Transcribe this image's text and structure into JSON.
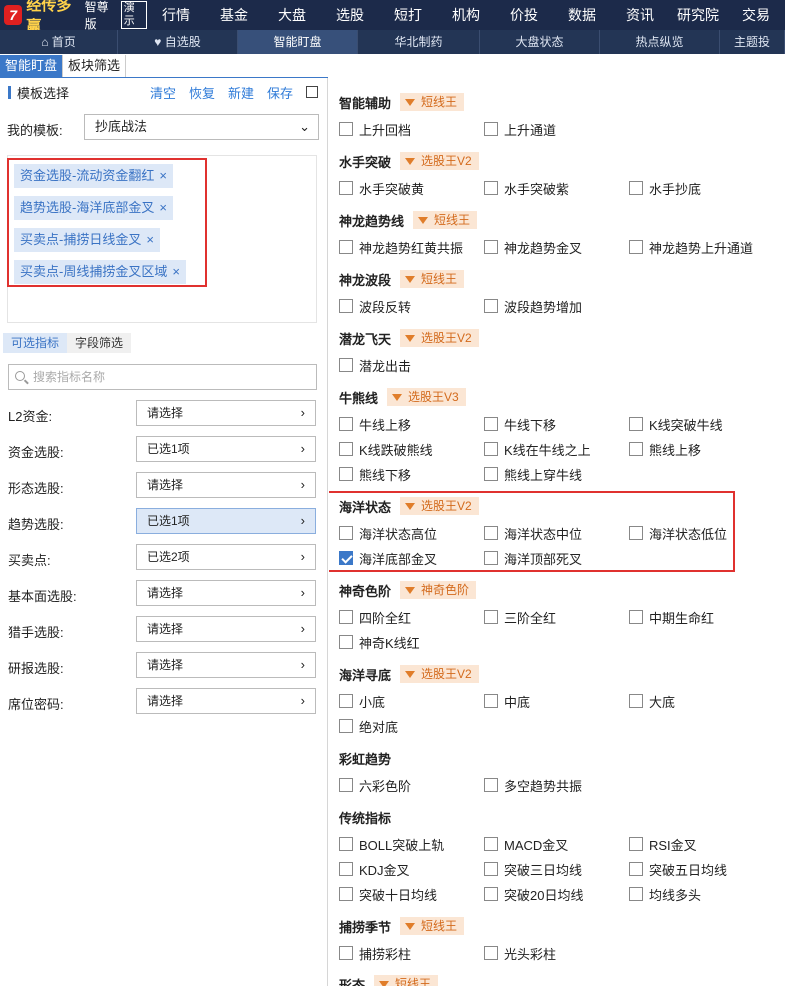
{
  "app": {
    "logo_text": "经传多赢",
    "edition": "智尊版",
    "demo": "演示"
  },
  "topnav": [
    "行情",
    "基金",
    "大盘",
    "选股",
    "短打",
    "机构",
    "价投",
    "数据",
    "资讯",
    "研究院",
    "交易"
  ],
  "tabs": [
    "首页",
    "自选股",
    "智能盯盘",
    "华北制药",
    "大盘状态",
    "热点纵览",
    "主题投"
  ],
  "subtabs": [
    "智能盯盘",
    "板块筛选"
  ],
  "template": {
    "title": "模板选择",
    "actions": [
      "清空",
      "恢复",
      "新建",
      "保存"
    ],
    "my_label": "我的模板:",
    "my_value": "抄底战法"
  },
  "tags": [
    "资金选股-流动资金翻红",
    "趋势选股-海洋底部金叉",
    "买卖点-捕捞日线金叉",
    "买卖点-周线捕捞金叉区域"
  ],
  "filter_tabs": [
    "可选指标",
    "字段筛选"
  ],
  "search_placeholder": "搜索指标名称",
  "filters": [
    {
      "label": "L2资金:",
      "value": "请选择"
    },
    {
      "label": "资金选股:",
      "value": "已选1项"
    },
    {
      "label": "形态选股:",
      "value": "请选择"
    },
    {
      "label": "趋势选股:",
      "value": "已选1项"
    },
    {
      "label": "买卖点:",
      "value": "已选2项"
    },
    {
      "label": "基本面选股:",
      "value": "请选择"
    },
    {
      "label": "猎手选股:",
      "value": "请选择"
    },
    {
      "label": "研报选股:",
      "value": "请选择"
    },
    {
      "label": "席位密码:",
      "value": "请选择"
    }
  ],
  "groups": [
    {
      "title": "智能辅助",
      "badge": "短线王",
      "items": [
        {
          "t": "上升回档",
          "c": false
        },
        {
          "t": "上升通道",
          "c": false
        }
      ]
    },
    {
      "title": "水手突破",
      "badge": "选股王V2",
      "items": [
        {
          "t": "水手突破黄",
          "c": false
        },
        {
          "t": "水手突破紫",
          "c": false
        },
        {
          "t": "水手抄底",
          "c": false
        }
      ]
    },
    {
      "title": "神龙趋势线",
      "badge": "短线王",
      "items": [
        {
          "t": "神龙趋势红黄共振",
          "c": false
        },
        {
          "t": "神龙趋势金叉",
          "c": false
        },
        {
          "t": "神龙趋势上升通道",
          "c": false
        }
      ]
    },
    {
      "title": "神龙波段",
      "badge": "短线王",
      "items": [
        {
          "t": "波段反转",
          "c": false
        },
        {
          "t": "波段趋势增加",
          "c": false
        }
      ]
    },
    {
      "title": "潜龙飞天",
      "badge": "选股王V2",
      "items": [
        {
          "t": "潜龙出击",
          "c": false
        }
      ]
    },
    {
      "title": "牛熊线",
      "badge": "选股王V3",
      "items": [
        {
          "t": "牛线上移",
          "c": false
        },
        {
          "t": "牛线下移",
          "c": false
        },
        {
          "t": "K线突破牛线",
          "c": false
        },
        {
          "t": "K线跌破熊线",
          "c": false
        },
        {
          "t": "K线在牛线之上",
          "c": false
        },
        {
          "t": "熊线上移",
          "c": false
        },
        {
          "t": "熊线下移",
          "c": false
        },
        {
          "t": "熊线上穿牛线",
          "c": false
        }
      ]
    },
    {
      "title": "海洋状态",
      "badge": "选股王V2",
      "items": [
        {
          "t": "海洋状态高位",
          "c": false
        },
        {
          "t": "海洋状态中位",
          "c": false
        },
        {
          "t": "海洋状态低位",
          "c": false
        },
        {
          "t": "海洋底部金叉",
          "c": true
        },
        {
          "t": "海洋顶部死叉",
          "c": false
        }
      ]
    },
    {
      "title": "神奇色阶",
      "badge": "神奇色阶",
      "items": [
        {
          "t": "四阶全红",
          "c": false
        },
        {
          "t": "三阶全红",
          "c": false
        },
        {
          "t": "中期生命红",
          "c": false
        },
        {
          "t": "神奇K线红",
          "c": false
        }
      ]
    },
    {
      "title": "海洋寻底",
      "badge": "选股王V2",
      "items": [
        {
          "t": "小底",
          "c": false
        },
        {
          "t": "中底",
          "c": false
        },
        {
          "t": "大底",
          "c": false
        },
        {
          "t": "绝对底",
          "c": false
        }
      ]
    },
    {
      "title": "彩虹趋势",
      "badge": "",
      "items": [
        {
          "t": "六彩色阶",
          "c": false
        },
        {
          "t": "多空趋势共振",
          "c": false
        }
      ]
    },
    {
      "title": "传统指标",
      "badge": "",
      "items": [
        {
          "t": "BOLL突破上轨",
          "c": false
        },
        {
          "t": "MACD金叉",
          "c": false
        },
        {
          "t": "RSI金叉",
          "c": false
        },
        {
          "t": "KDJ金叉",
          "c": false
        },
        {
          "t": "突破三日均线",
          "c": false
        },
        {
          "t": "突破五日均线",
          "c": false
        },
        {
          "t": "突破十日均线",
          "c": false
        },
        {
          "t": "突破20日均线",
          "c": false
        },
        {
          "t": "均线多头",
          "c": false
        }
      ]
    },
    {
      "title": "捕捞季节",
      "badge": "短线王",
      "items": [
        {
          "t": "捕捞彩柱",
          "c": false
        },
        {
          "t": "光头彩柱",
          "c": false
        }
      ]
    },
    {
      "title": "形态",
      "badge": "短线王",
      "items": []
    }
  ],
  "colors": {
    "accent": "#3b78c8",
    "highlight_box": "#e0312f",
    "badge_bg": "#fbe6d4",
    "badge_fg": "#d36a1c",
    "topbar": "#1c2a4a"
  }
}
